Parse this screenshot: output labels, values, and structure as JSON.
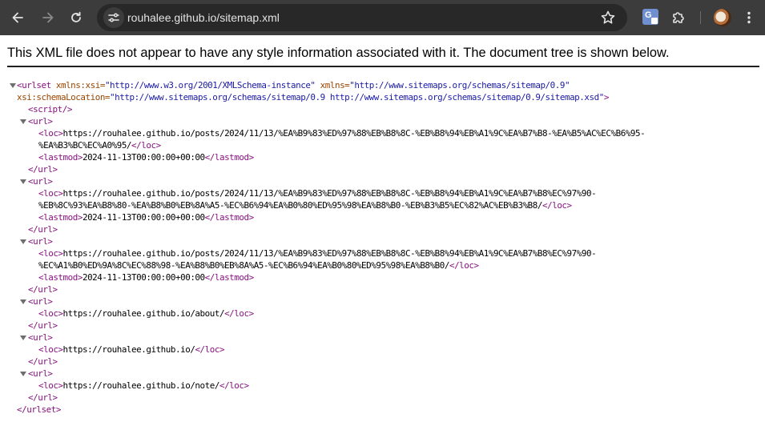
{
  "browser": {
    "url": "rouhalee.github.io/sitemap.xml",
    "icons": {
      "back": "arrow-left-icon",
      "forward": "arrow-right-icon",
      "reload": "reload-icon",
      "site_info": "tune-icon",
      "bookmark": "star-icon",
      "translate": "google-translate-icon",
      "extensions": "puzzle-icon",
      "profile": "avatar",
      "menu": "kebab-menu-icon"
    },
    "colors": {
      "toolbar": "#3c3c3c",
      "omnibox": "#282828"
    }
  },
  "xml_viewer": {
    "header": "This XML file does not appear to have any style information associated with it. The document tree is shown below.",
    "urlset_open_1": "<urlset",
    "xmlns_xsi_attr": "xmlns:xsi=",
    "xmlns_xsi_val": "\"http://www.w3.org/2001/XMLSchema-instance\"",
    "xmlns_attr": "xmlns=",
    "xmlns_val": "\"http://www.sitemaps.org/schemas/sitemap/0.9\"",
    "schema_attr": "xsi:schemaLocation=",
    "schema_val": "\"http://www.sitemaps.org/schemas/sitemap/0.9 http://www.sitemaps.org/schemas/sitemap/0.9/sitemap.xsd\"",
    "urlset_open_end": ">",
    "script_tag": "<script/>",
    "url_open": "<url>",
    "url_close": "</url>",
    "loc_open": "<loc>",
    "loc_close": "</loc>",
    "lastmod_open": "<lastmod>",
    "lastmod_close": "</lastmod>",
    "urlset_close": "</urlset>",
    "urls": [
      {
        "loc_line1": "https://rouhalee.github.io/posts/2024/11/13/%EA%B9%83%ED%97%88%EB%B8%8C-%EB%B8%94%EB%A1%9C%EA%B7%B8-%EA%B5%AC%EC%B6%95-",
        "loc_line2": "%EA%B3%BC%EC%A0%95/",
        "lastmod": "2024-11-13T00:00:00+00:00"
      },
      {
        "loc_line1": "https://rouhalee.github.io/posts/2024/11/13/%EA%B9%83%ED%97%88%EB%B8%8C-%EB%B8%94%EB%A1%9C%EA%B7%B8%EC%97%90-",
        "loc_line2": "%EB%8C%93%EA%B8%80-%EA%B8%B0%EB%8A%A5-%EC%B6%94%EA%B0%80%ED%95%98%EA%B8%B0-%EB%B3%B5%EC%82%AC%EB%B3%B8/",
        "lastmod": "2024-11-13T00:00:00+00:00"
      },
      {
        "loc_line1": "https://rouhalee.github.io/posts/2024/11/13/%EA%B9%83%ED%97%88%EB%B8%8C-%EB%B8%94%EB%A1%9C%EA%B7%B8%EC%97%90-",
        "loc_line2": "%EC%A1%B0%ED%9A%8C%EC%88%98-%EA%B8%B0%EB%8A%A5-%EC%B6%94%EA%B0%80%ED%95%98%EA%B8%B0/",
        "lastmod": "2024-11-13T00:00:00+00:00"
      },
      {
        "loc": "https://rouhalee.github.io/about/"
      },
      {
        "loc": "https://rouhalee.github.io/"
      },
      {
        "loc": "https://rouhalee.github.io/note/"
      }
    ],
    "colors": {
      "tag": "#881280",
      "attr_name": "#994500",
      "attr_value": "#1a1aa6"
    }
  }
}
